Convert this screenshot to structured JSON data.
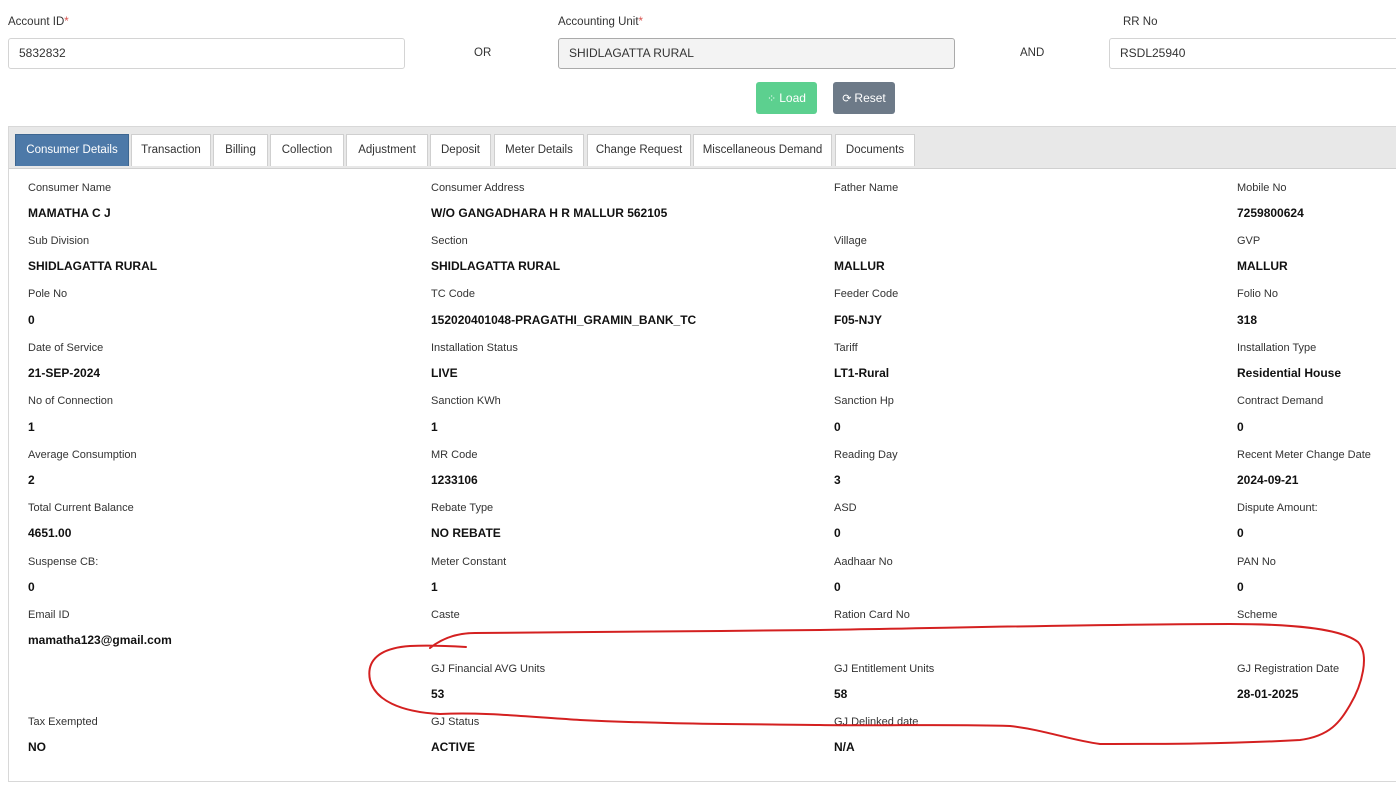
{
  "search": {
    "account_id_label": "Account ID",
    "account_id_value": "5832832",
    "or_label": "OR",
    "accounting_unit_label": "Accounting Unit",
    "accounting_unit_value": "SHIDLAGATTA RURAL",
    "and_label": "AND",
    "rr_no_label": "RR No",
    "rr_no_value": "RSDL25940",
    "required_mark": "*"
  },
  "buttons": {
    "load": "Load",
    "reset": "Reset"
  },
  "tabs": [
    "Consumer Details",
    "Transaction",
    "Billing",
    "Collection",
    "Adjustment",
    "Deposit",
    "Meter Details",
    "Change Request",
    "Miscellaneous Demand",
    "Documents"
  ],
  "active_tab": "Consumer Details",
  "fields": {
    "consumer_name": {
      "label": "Consumer Name",
      "value": "MAMATHA C J"
    },
    "consumer_address": {
      "label": "Consumer Address",
      "value": "W/O GANGADHARA H R MALLUR 562105"
    },
    "father_name": {
      "label": "Father Name",
      "value": ""
    },
    "mobile_no": {
      "label": "Mobile No",
      "value": "7259800624"
    },
    "sub_division": {
      "label": "Sub Division",
      "value": "SHIDLAGATTA RURAL"
    },
    "section": {
      "label": "Section",
      "value": "SHIDLAGATTA RURAL"
    },
    "village": {
      "label": "Village",
      "value": "MALLUR"
    },
    "gvp": {
      "label": "GVP",
      "value": "MALLUR"
    },
    "pole_no": {
      "label": "Pole No",
      "value": "0"
    },
    "tc_code": {
      "label": "TC Code",
      "value": "152020401048-PRAGATHI_GRAMIN_BANK_TC"
    },
    "feeder_code": {
      "label": "Feeder Code",
      "value": "F05-NJY"
    },
    "folio_no": {
      "label": "Folio No",
      "value": "318"
    },
    "date_of_service": {
      "label": "Date of Service",
      "value": "21-SEP-2024"
    },
    "installation_status": {
      "label": "Installation Status",
      "value": "LIVE"
    },
    "tariff": {
      "label": "Tariff",
      "value": "LT1-Rural"
    },
    "installation_type": {
      "label": "Installation Type",
      "value": "Residential House"
    },
    "no_of_connection": {
      "label": "No of Connection",
      "value": "1"
    },
    "sanction_kwh": {
      "label": "Sanction KWh",
      "value": "1"
    },
    "sanction_hp": {
      "label": "Sanction Hp",
      "value": "0"
    },
    "contract_demand": {
      "label": "Contract Demand",
      "value": "0"
    },
    "average_consumption": {
      "label": "Average Consumption",
      "value": "2"
    },
    "mr_code": {
      "label": "MR Code",
      "value": "1233106"
    },
    "reading_day": {
      "label": "Reading Day",
      "value": "3"
    },
    "recent_meter_change_date": {
      "label": "Recent Meter Change Date",
      "value": "2024-09-21"
    },
    "total_current_balance": {
      "label": "Total Current Balance",
      "value": "4651.00"
    },
    "rebate_type": {
      "label": "Rebate Type",
      "value": "NO REBATE"
    },
    "asd": {
      "label": "ASD",
      "value": "0"
    },
    "dispute_amount": {
      "label": "Dispute Amount:",
      "value": "0"
    },
    "suspense_cb": {
      "label": "Suspense CB:",
      "value": "0"
    },
    "meter_constant": {
      "label": "Meter Constant",
      "value": "1"
    },
    "aadhaar_no": {
      "label": "Aadhaar No",
      "value": "0"
    },
    "pan_no": {
      "label": "PAN No",
      "value": "0"
    },
    "email_id": {
      "label": "Email ID",
      "value": "mamatha123@gmail.com"
    },
    "caste": {
      "label": "Caste",
      "value": ""
    },
    "ration_card_no": {
      "label": "Ration Card No",
      "value": ""
    },
    "scheme": {
      "label": "Scheme",
      "value": ""
    },
    "gj_financial_avg_units": {
      "label": "GJ Financial AVG Units",
      "value": "53"
    },
    "gj_entitlement_units": {
      "label": "GJ Entitlement Units",
      "value": "58"
    },
    "gj_registration_date": {
      "label": "GJ Registration Date",
      "value": "28-01-2025"
    },
    "tax_exempted": {
      "label": "Tax Exempted",
      "value": "NO"
    },
    "gj_status": {
      "label": "GJ Status",
      "value": "ACTIVE"
    },
    "gj_delinked_date": {
      "label": "GJ Delinked date",
      "value": "N/A"
    }
  },
  "colors": {
    "load_button": "#5cd08f",
    "reset_button": "#6d7a88",
    "active_tab": "#4d79a8",
    "annotation_stroke": "#d42020"
  }
}
